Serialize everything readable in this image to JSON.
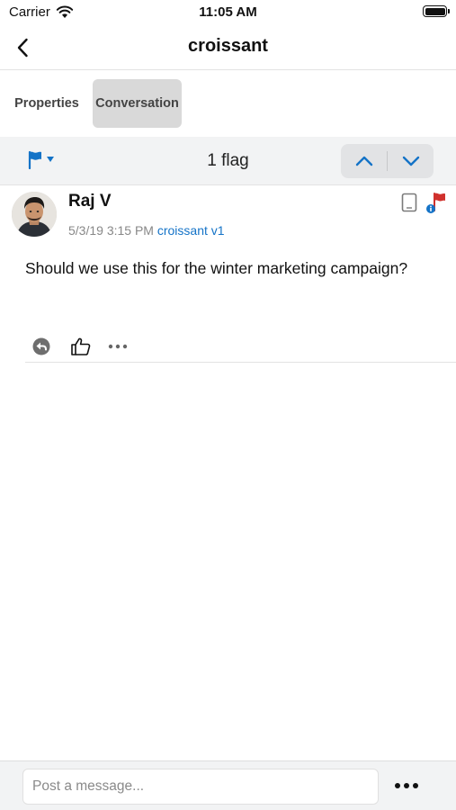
{
  "status_bar": {
    "carrier": "Carrier",
    "time": "11:05 AM"
  },
  "nav": {
    "title": "croissant",
    "back_icon": "chevron-left-icon"
  },
  "tabs": [
    {
      "label": "Properties",
      "selected": false
    },
    {
      "label": "Conversation",
      "selected": true
    }
  ],
  "flag_bar": {
    "filter_icon": "flag-icon",
    "count_label": "1 flag",
    "prev_icon": "chevron-up-icon",
    "next_icon": "chevron-down-icon"
  },
  "comment": {
    "author": "Raj V",
    "timestamp": "5/3/19 3:15 PM",
    "version": "croissant v1",
    "body": "Should we use this for the winter marketing campaign?",
    "device_icon": "tablet-icon",
    "flag_icon": "red-flag-icon",
    "actions": [
      "reply-icon",
      "thumbs-up-icon",
      "more-icon"
    ]
  },
  "composer": {
    "placeholder": "Post a message...",
    "value": ""
  },
  "colors": {
    "accent": "#1473c7",
    "flag_red": "#d0312d",
    "bar_bg": "#f2f3f4",
    "tab_selected_bg": "#d9d9d9"
  }
}
